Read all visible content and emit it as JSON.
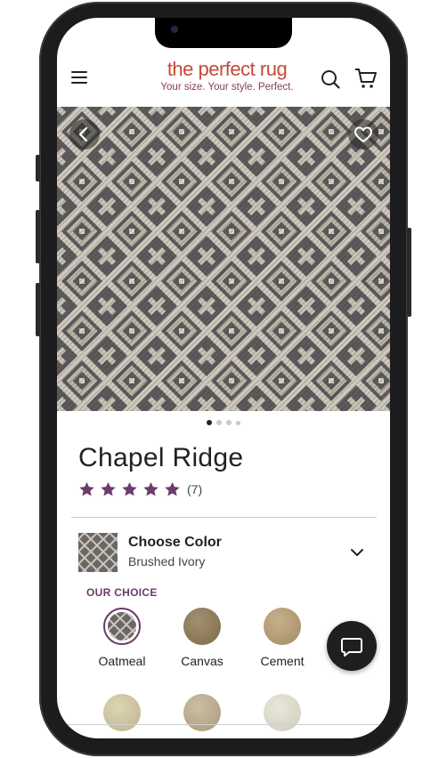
{
  "header": {
    "logo_name": "the perfect rug",
    "logo_tagline": "Your size. Your style. Perfect.",
    "menu_icon": "hamburger-menu-icon",
    "search_icon": "search-icon",
    "cart_icon": "cart-icon"
  },
  "gallery": {
    "back_icon": "chevron-left-icon",
    "favorite_icon": "heart-icon",
    "image_count": 4,
    "active_index": 0
  },
  "product": {
    "title": "Chapel Ridge",
    "rating": 5,
    "rating_max": 5,
    "review_count": "(7)"
  },
  "color_picker": {
    "heading": "Choose Color",
    "selected_value": "Brushed Ivory",
    "our_choice_label": "OUR CHOICE",
    "options": [
      {
        "label": "Oatmeal",
        "color": "#8f8b82",
        "selected": true
      },
      {
        "label": "Canvas",
        "color": "#8a7656"
      },
      {
        "label": "Cement",
        "color": "#b29a72"
      },
      {
        "label": "",
        "color": "#c9c29c"
      },
      {
        "label": "",
        "color": "#b9ab8f"
      },
      {
        "label": "",
        "color": "#d9d8c8"
      }
    ]
  },
  "chat": {
    "icon": "chat-bubble-icon"
  },
  "colors": {
    "accent": "#6b3b6b",
    "brand_red": "#c44a3a"
  }
}
